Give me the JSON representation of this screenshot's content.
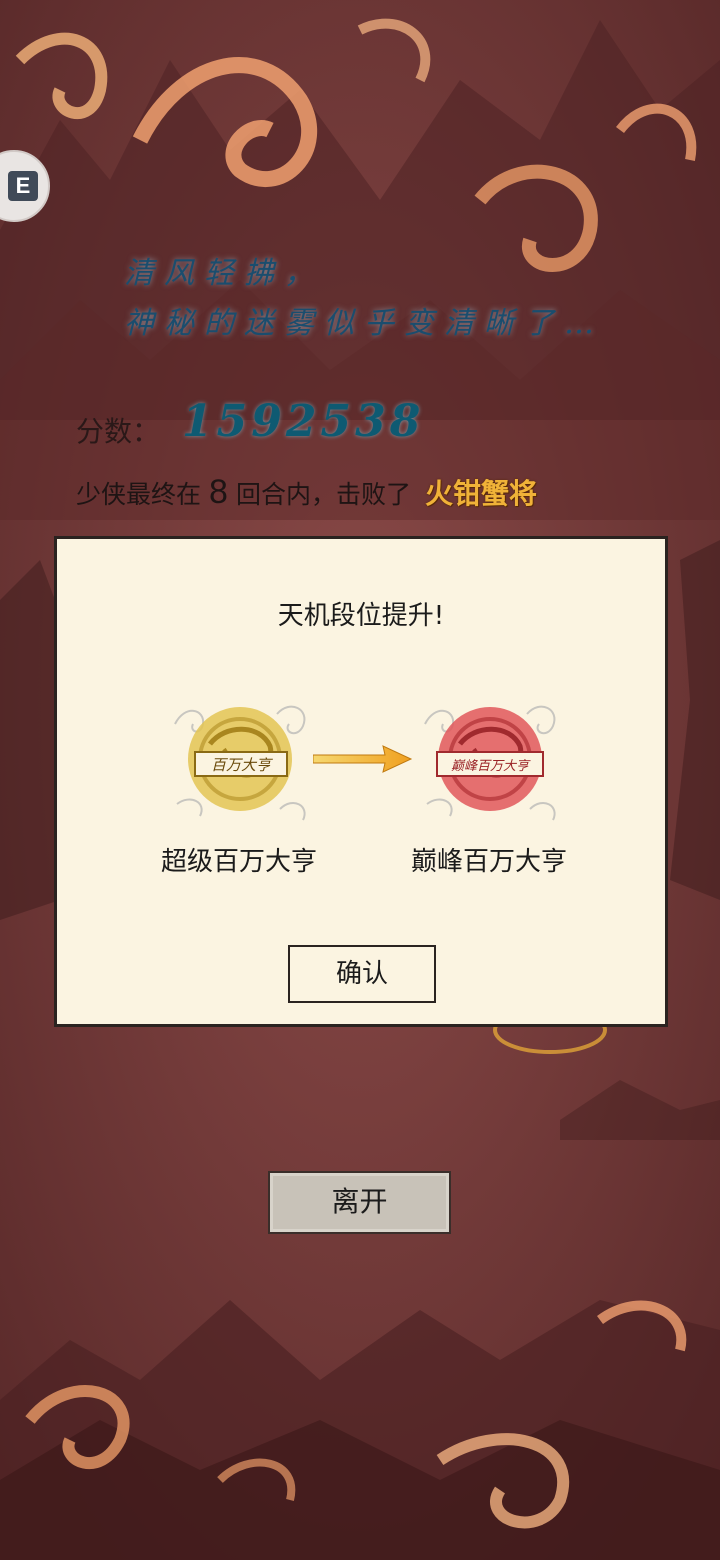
{
  "poem": {
    "line1": "清风轻拂，",
    "line2": "神秘的迷雾似乎变清晰了…"
  },
  "score": {
    "label": "分数：",
    "value": "1592538"
  },
  "summary": {
    "prefix": "少侠最终在",
    "rounds": "8",
    "middle": "回合内，击败了",
    "boss": "火钳蟹将"
  },
  "dialog": {
    "title": "天机段位提升!",
    "from_rank": {
      "name": "超级百万大亨",
      "seal_text": "百万大亨",
      "color": "#e3c454"
    },
    "to_rank": {
      "name": "巅峰百万大亨",
      "seal_text": "巅峰百万大亨",
      "color": "#e0575a"
    },
    "confirm_label": "确认"
  },
  "leave_label": "离开",
  "corner_icon": {
    "name": "floating-app-icon",
    "glyph": "E"
  },
  "colors": {
    "background": "#6e3433",
    "panel": "#fbf4e1",
    "boss_name": "#f0b238",
    "poem": "#1a4d6e",
    "score": "#0e5a72"
  }
}
